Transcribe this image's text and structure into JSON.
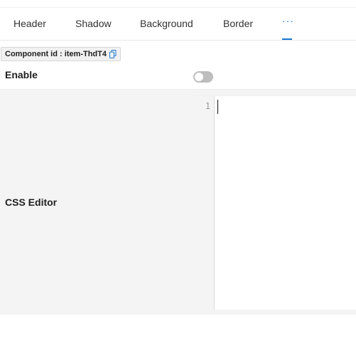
{
  "tabs": [
    {
      "label": "Header"
    },
    {
      "label": "Shadow"
    },
    {
      "label": "Background"
    },
    {
      "label": "Border"
    },
    {
      "label": "···",
      "active": true
    }
  ],
  "component": {
    "id_text": "Component id : item-ThdT4"
  },
  "enable": {
    "label": "Enable",
    "on": false
  },
  "css_editor": {
    "label": "CSS Editor",
    "line_numbers": [
      "1"
    ]
  },
  "colors": {
    "accent": "#1677d2",
    "toggle_off": "#bdbdbd",
    "panel_bg": "#f4f4f4"
  },
  "icons": {
    "copy": "copy-icon"
  }
}
